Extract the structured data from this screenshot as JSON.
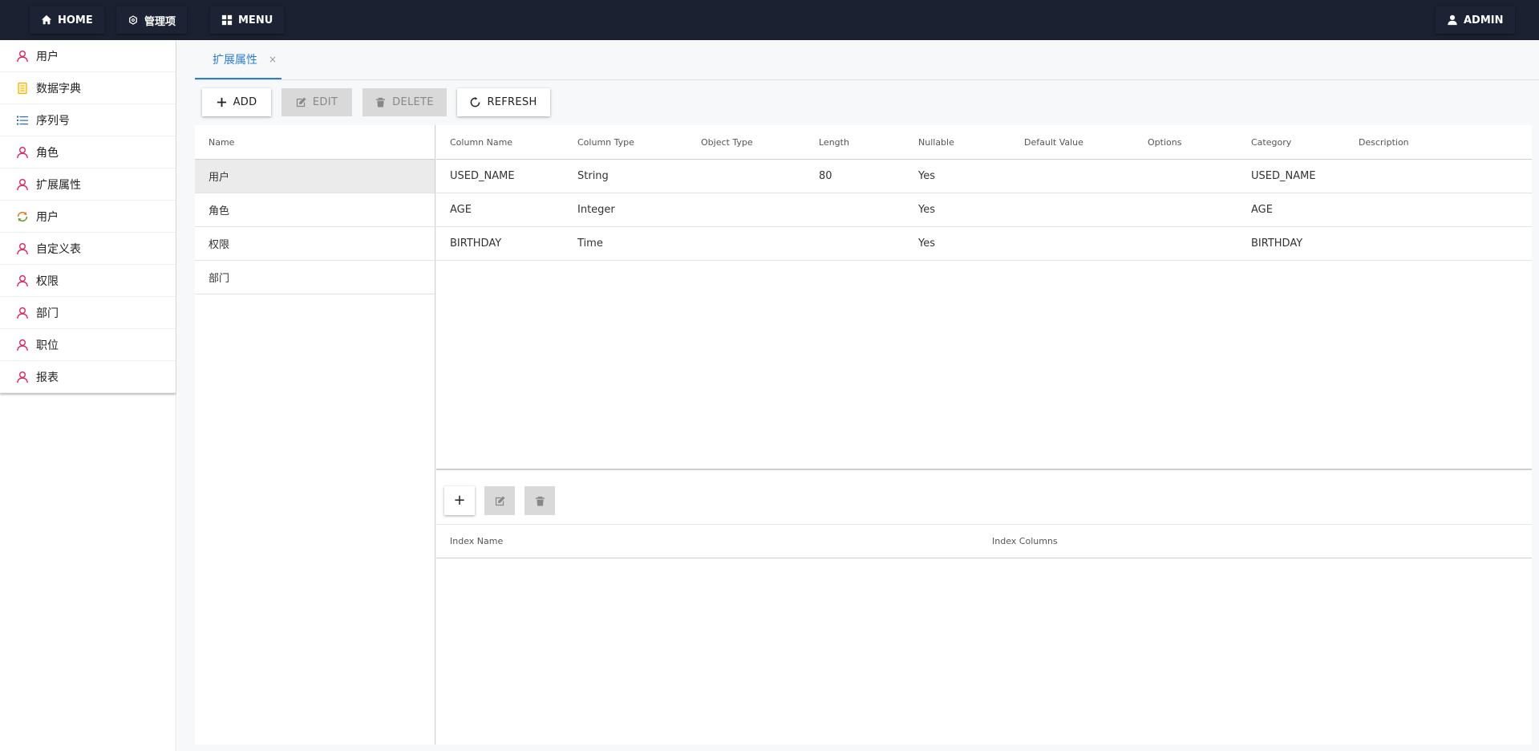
{
  "topbar": {
    "home": "HOME",
    "manage": "管理项",
    "menu": "MENU",
    "admin": "ADMIN"
  },
  "sidebar": {
    "items": [
      {
        "label": "用户",
        "icon": "user-icon"
      },
      {
        "label": "数据字典",
        "icon": "notebook-icon"
      },
      {
        "label": "序列号",
        "icon": "list-icon"
      },
      {
        "label": "角色",
        "icon": "user-icon"
      },
      {
        "label": "扩展属性",
        "icon": "user-icon"
      },
      {
        "label": "用户",
        "icon": "sync-icon"
      },
      {
        "label": "自定义表",
        "icon": "user-icon"
      },
      {
        "label": "权限",
        "icon": "user-icon"
      },
      {
        "label": "部门",
        "icon": "user-icon"
      },
      {
        "label": "职位",
        "icon": "user-icon"
      },
      {
        "label": "报表",
        "icon": "user-icon"
      }
    ]
  },
  "tabs": [
    {
      "label": "扩展属性",
      "close": "×"
    }
  ],
  "toolbar": {
    "add": "ADD",
    "edit": "EDIT",
    "delete": "DELETE",
    "refresh": "REFRESH"
  },
  "names": {
    "header": "Name",
    "rows": [
      "用户",
      "角色",
      "权限",
      "部门"
    ]
  },
  "columns": {
    "headers": [
      "Column Name",
      "Column Type",
      "Object Type",
      "Length",
      "Nullable",
      "Default Value",
      "Options",
      "Category",
      "Description"
    ],
    "rows": [
      [
        "USED_NAME",
        "String",
        "",
        "80",
        "Yes",
        "",
        "",
        "USED_NAME",
        ""
      ],
      [
        "AGE",
        "Integer",
        "",
        "",
        "Yes",
        "",
        "",
        "AGE",
        ""
      ],
      [
        "BIRTHDAY",
        "Time",
        "",
        "",
        "Yes",
        "",
        "",
        "BIRTHDAY",
        ""
      ]
    ]
  },
  "indexes": {
    "headers": [
      "Index Name",
      "Index Columns"
    ],
    "add_label": "+"
  },
  "colors": {
    "topbar": "#1b2131",
    "accent": "#2a7fd4",
    "user_icon": "#e0245e",
    "notebook_icon": "#f0b400",
    "list_icon": "#1f6fd1",
    "sync_icon": "#e07a1f"
  }
}
